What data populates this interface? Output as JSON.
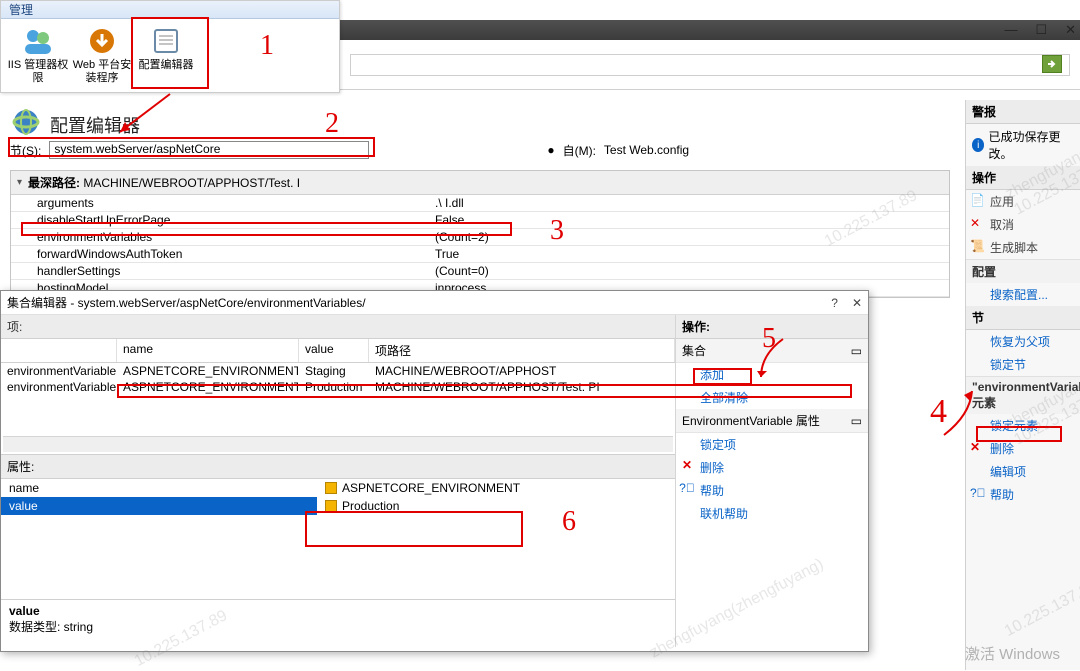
{
  "ribbon": {
    "tab": "管理",
    "items": [
      {
        "label": "IIS 管理器权限",
        "icon": "users-icon"
      },
      {
        "label": "Web 平台安装程序",
        "icon": "download-icon"
      },
      {
        "label": "配置编辑器",
        "icon": "config-icon"
      }
    ]
  },
  "windowControls": {
    "min": "—",
    "max": "☐",
    "close": "✕"
  },
  "page": {
    "title": "配置编辑器",
    "section_label": "节(S):",
    "section_value": "system.webServer/aspNetCore",
    "from_label": "自(M):",
    "from_value": "Test                              Web.config",
    "from_bullet": "●"
  },
  "grid": {
    "header_prefix": "最深路径:",
    "header_path": "MACHINE/WEBROOT/APPHOST/Test.                           I",
    "rows": [
      {
        "name": "arguments",
        "value": ".\\                             I.dll"
      },
      {
        "name": "disableStartUpErrorPage",
        "value": "False"
      },
      {
        "name": "environmentVariables",
        "value": "(Count=2)"
      },
      {
        "name": "forwardWindowsAuthToken",
        "value": "True"
      },
      {
        "name": "handlerSettings",
        "value": "(Count=0)"
      },
      {
        "name": "hostingModel",
        "value": "inprocess"
      }
    ]
  },
  "dialog": {
    "title": "集合编辑器 - system.webServer/aspNetCore/environmentVariables/",
    "help": "?",
    "close": "✕",
    "items_head": "项:",
    "columns": {
      "name": "name",
      "value": "value",
      "path": "项路径"
    },
    "rows": [
      {
        "t": "environmentVariable",
        "name": "ASPNETCORE_ENVIRONMENT",
        "value": "Staging",
        "path": "MACHINE/WEBROOT/APPHOST"
      },
      {
        "t": "environmentVariable",
        "name": "ASPNETCORE_ENVIRONMENT",
        "value": "Production",
        "path": "MACHINE/WEBROOT/APPHOST/Test.                                       PI"
      }
    ],
    "props_head": "属性:",
    "props": [
      {
        "n": "name",
        "v": "ASPNETCORE_ENVIRONMENT"
      },
      {
        "n": "value",
        "v": "Production"
      }
    ],
    "desc_title": "value",
    "desc_body": "数据类型: string",
    "actions_head": "操作:",
    "collection_head": "集合",
    "collection_items": [
      {
        "label": "添加",
        "icon": ""
      },
      {
        "label": "全部清除",
        "icon": ""
      }
    ],
    "ev_head": "EnvironmentVariable 属性",
    "ev_items": [
      {
        "label": "锁定项",
        "icon": ""
      },
      {
        "label": "删除",
        "icon": "x"
      }
    ],
    "help_items": [
      {
        "label": "帮助",
        "icon": "?"
      },
      {
        "label": "联机帮助",
        "icon": ""
      }
    ]
  },
  "sidebar": {
    "alerts_head": "警报",
    "alert_msg": "已成功保存更改。",
    "actions_head": "操作",
    "top_actions": [
      {
        "label": "应用",
        "link": false
      },
      {
        "label": "取消",
        "link": false,
        "icon": "x"
      },
      {
        "label": "生成脚本",
        "link": false
      }
    ],
    "config_head": "配置",
    "config_items": [
      {
        "label": "搜索配置...",
        "link": true
      }
    ],
    "section_head": "节",
    "section_items": [
      {
        "label": "恢复为父项",
        "link": true
      },
      {
        "label": "锁定节",
        "link": true
      }
    ],
    "elem_head": "\"environmentVariable\" 元素",
    "elem_items": [
      {
        "label": "锁定元素",
        "link": true
      },
      {
        "label": "删除",
        "link": true,
        "icon": "x"
      },
      {
        "label": "编辑项",
        "link": true
      },
      {
        "label": "帮助",
        "link": true,
        "icon": "?"
      }
    ]
  },
  "annotations": [
    "1",
    "2",
    "3",
    "4",
    "5",
    "6"
  ],
  "activate": "激活 Windows"
}
